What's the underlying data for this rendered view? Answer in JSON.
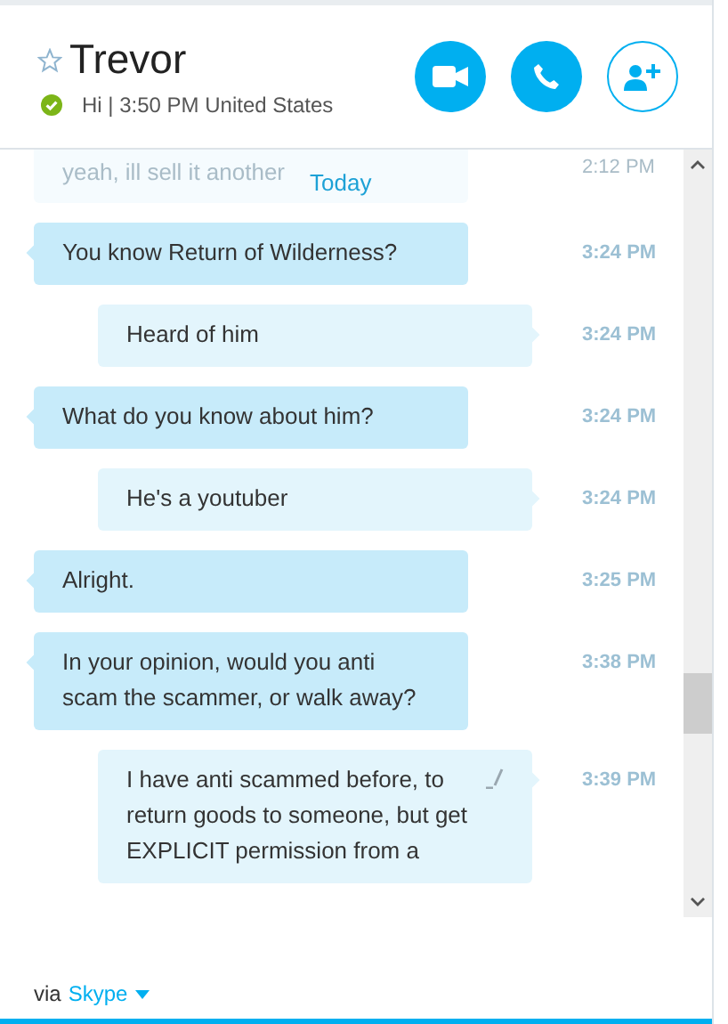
{
  "contact": {
    "name": "Trevor",
    "favorite": false,
    "status_line": "Hi | 3:50 PM United States"
  },
  "previous_message": {
    "text": "yeah, ill sell it another",
    "time": "2:12 PM"
  },
  "date_divider": "Today",
  "messages": [
    {
      "kind": "them",
      "text": "You know Return of Wilderness?",
      "time": "3:24 PM",
      "edited": false
    },
    {
      "kind": "me",
      "text": "Heard of him",
      "time": "3:24 PM",
      "edited": false
    },
    {
      "kind": "them",
      "text": "What do you know about him?",
      "time": "3:24 PM",
      "edited": false
    },
    {
      "kind": "me",
      "text": "He's a youtuber",
      "time": "3:24 PM",
      "edited": false
    },
    {
      "kind": "them",
      "text": "Alright.",
      "time": "3:25 PM",
      "edited": false
    },
    {
      "kind": "them",
      "text": "In your opinion, would you anti scam the scammer, or walk away?",
      "time": "3:38 PM",
      "edited": false
    },
    {
      "kind": "me",
      "text": "I have anti scammed before, to return goods to someone, but get EXPLICIT permission from a",
      "time": "3:39 PM",
      "edited": true
    }
  ],
  "footer": {
    "prefix": "via",
    "service": "Skype"
  }
}
